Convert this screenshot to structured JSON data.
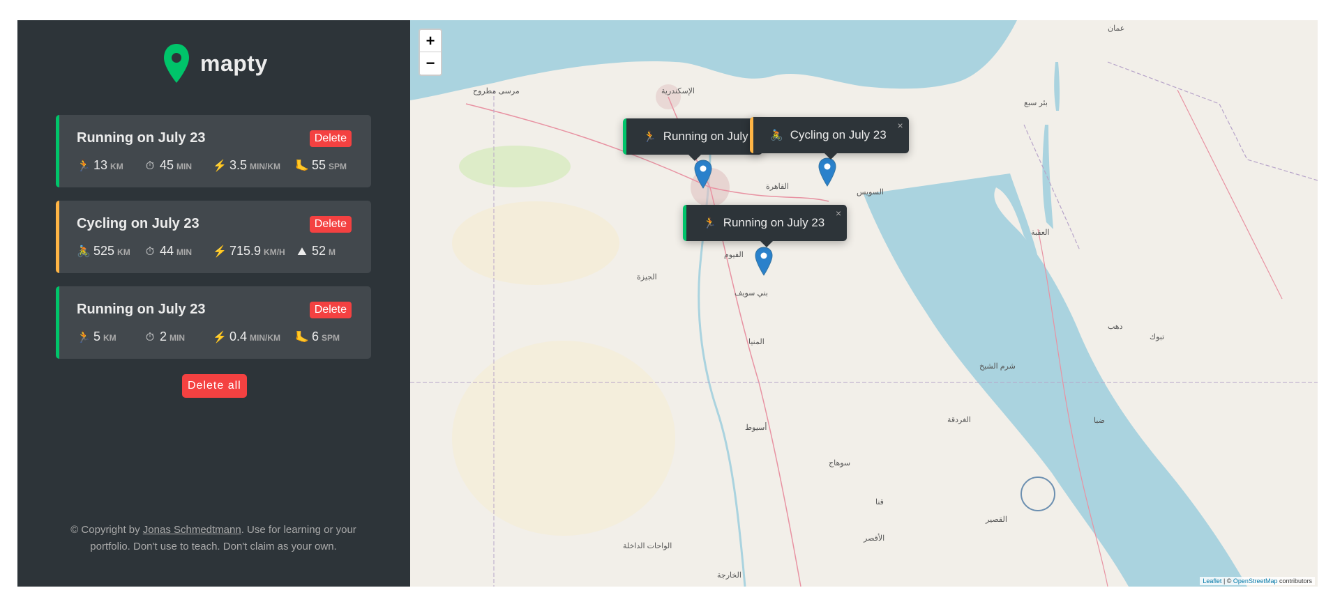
{
  "app": {
    "logo_text": "mapty"
  },
  "workouts": [
    {
      "type": "running",
      "title": "Running on July 23",
      "delete_label": "Delete",
      "stats": [
        {
          "icon": "running-icon",
          "value": "13",
          "unit": "KM"
        },
        {
          "icon": "stopwatch-icon",
          "value": "45",
          "unit": "MIN"
        },
        {
          "icon": "lightning-icon",
          "value": "3.5",
          "unit": "MIN/KM"
        },
        {
          "icon": "foot-icon",
          "value": "55",
          "unit": "SPM"
        }
      ]
    },
    {
      "type": "cycling",
      "title": "Cycling on July 23",
      "delete_label": "Delete",
      "stats": [
        {
          "icon": "cycling-icon",
          "value": "525",
          "unit": "KM"
        },
        {
          "icon": "stopwatch-icon",
          "value": "44",
          "unit": "MIN"
        },
        {
          "icon": "lightning-icon",
          "value": "715.9",
          "unit": "KM/H"
        },
        {
          "icon": "mountain-icon",
          "value": "52",
          "unit": "M"
        }
      ]
    },
    {
      "type": "running",
      "title": "Running on July 23",
      "delete_label": "Delete",
      "stats": [
        {
          "icon": "running-icon",
          "value": "5",
          "unit": "KM"
        },
        {
          "icon": "stopwatch-icon",
          "value": "2",
          "unit": "MIN"
        },
        {
          "icon": "lightning-icon",
          "value": "0.4",
          "unit": "MIN/KM"
        },
        {
          "icon": "foot-icon",
          "value": "6",
          "unit": "SPM"
        }
      ]
    }
  ],
  "delete_all_label": "Delete all",
  "copyright": {
    "prefix": "© Copyright by ",
    "author": "Jonas Schmedtmann",
    "suffix": ". Use for learning or your portfolio. Don't use to teach. Don't claim as your own."
  },
  "map": {
    "zoom_in": "+",
    "zoom_out": "−",
    "popups": [
      {
        "type": "running",
        "label": "Running on July",
        "close": "×"
      },
      {
        "type": "cycling",
        "label": "Cycling on July 23",
        "close": "×"
      },
      {
        "type": "running",
        "label": "Running on July 23",
        "close": "×"
      }
    ],
    "attribution": {
      "leaflet": "Leaflet",
      "sep": " | © ",
      "osm": "OpenStreetMap",
      "suffix": " contributors"
    },
    "cities": [
      "القاهرة",
      "الإسكندرية",
      "السويس",
      "أسيوط",
      "الأقصر",
      "تبوك",
      "العقبة",
      "الغردقة",
      "سوهاج",
      "قنا",
      "المنيا",
      "بني سويف",
      "شرم الشيخ",
      "مرسى مطروح",
      "الواحات الداخلة",
      "الخارجة",
      "دهب",
      "ضبا",
      "القصير",
      "الفيوم",
      "الجيزة",
      "عمان",
      "بئر سبع"
    ]
  },
  "colors": {
    "running": "#00c46a",
    "cycling": "#ffb545",
    "sidebar": "#2d3439",
    "card": "#42484d",
    "delete": "#f44141"
  }
}
